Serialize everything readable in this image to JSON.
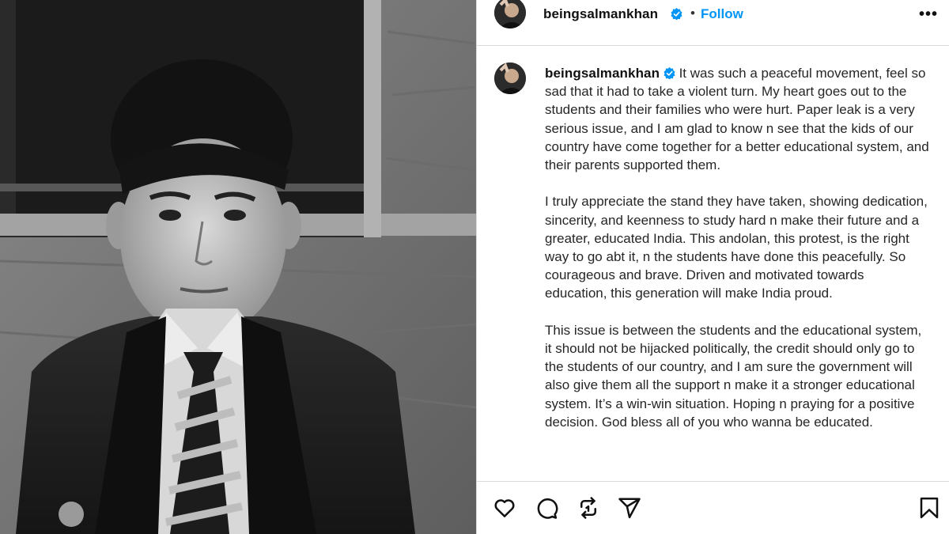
{
  "post": {
    "username": "beingsalmankhan",
    "verified_icon": "verified-badge-icon",
    "separator": "•",
    "follow_label": "Follow",
    "more_label": "•••",
    "photo_description_icon": "post-photo"
  },
  "caption": {
    "username": "beingsalmankhan",
    "paragraphs": [
      "It was such a peaceful movement, feel so sad that it had to take a violent turn. My heart goes out to the students and their families who were hurt. Paper leak is a very serious issue, and I am glad to know n see that the kids of our country have come together for a better educational system, and their parents supported them.",
      "I truly appreciate the stand they have taken, showing dedication, sincerity, and keenness to study hard n make their future and a greater, educated India. This andolan, this protest, is the right way to go abt it, n the students have done this peacefully. So courageous and brave. Driven and motivated towards education, this generation will make India proud.",
      "This issue is between the students and the educational system, it should not be hijacked politically, the credit should only go to the students of our country, and I am sure the government will also give them all the support n make it a stronger educational system. It’s a win-win situation. Hoping n praying for a positive decision. God bless all of you who wanna be educated."
    ]
  },
  "actions": {
    "like_icon": "heart-icon",
    "comment_icon": "comment-icon",
    "repost_icon": "repost-icon",
    "share_icon": "send-icon",
    "save_icon": "bookmark-icon"
  },
  "colors": {
    "accent": "#0095f6",
    "text": "#262626",
    "divider": "#dbdbdb"
  }
}
